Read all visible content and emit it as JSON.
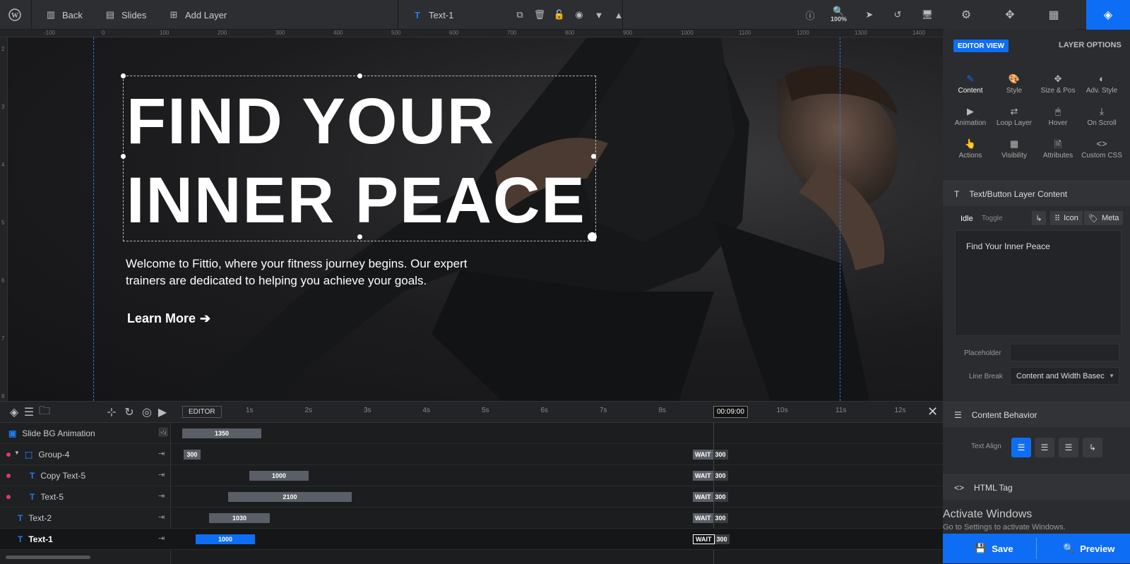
{
  "topbar": {
    "back_label": "Back",
    "slides_label": "Slides",
    "add_layer_label": "Add Layer",
    "selected_layer": "Text-1",
    "zoom": "100%"
  },
  "ruler_labels": [
    "-100",
    "0",
    "100",
    "200",
    "300",
    "400",
    "500",
    "600",
    "700",
    "800",
    "900",
    "1000",
    "1100",
    "1200",
    "1300",
    "1400"
  ],
  "vruler_labels": [
    "2",
    "3",
    "4",
    "5",
    "6",
    "7",
    "8"
  ],
  "canvas": {
    "headline": "FIND YOUR\nINNER PEACE",
    "subtext": "Welcome to Fittio, where your fitness journey begins. Our expert trainers are dedicated to helping you achieve your goals.",
    "button_label": "Learn More"
  },
  "timeline": {
    "editor_label": "EDITOR",
    "current_time": "00:09:00",
    "ticks": [
      "1s",
      "2s",
      "3s",
      "4s",
      "5s",
      "6s",
      "7s",
      "8s",
      "9s",
      "10s",
      "11s",
      "12s"
    ],
    "wait_label": "WAIT",
    "rows": [
      {
        "name": "Slide BG Animation",
        "bar": "1350",
        "wait": "",
        "end": ""
      },
      {
        "name": "Group-4",
        "bar": "300",
        "wait": "WAIT",
        "end": "300"
      },
      {
        "name": "Copy Text-5",
        "bar": "1000",
        "wait": "WAIT",
        "end": "300"
      },
      {
        "name": "Text-5",
        "bar": "2100",
        "wait": "WAIT",
        "end": "300"
      },
      {
        "name": "Text-2",
        "bar": "1030",
        "wait": "WAIT",
        "end": "300"
      },
      {
        "name": "Text-1",
        "bar": "1000",
        "wait": "WAIT",
        "end": "300"
      }
    ]
  },
  "panel": {
    "editor_view": "EDITOR VIEW",
    "layer_options": "LAYER OPTIONS",
    "options": [
      "Content",
      "Style",
      "Size & Pos",
      "Adv. Style",
      "Animation",
      "Loop Layer",
      "Hover",
      "On Scroll",
      "Actions",
      "Visibility",
      "Attributes",
      "Custom CSS"
    ],
    "content_section": "Text/Button Layer Content",
    "idle": "Idle",
    "toggle": "Toggle",
    "icon_label": "Icon",
    "meta_label": "Meta",
    "content_text": "Find Your Inner Peace",
    "placeholder_label": "Placeholder",
    "placeholder_value": "",
    "linebreak_label": "Line Break",
    "linebreak_value": "Content and Width Basec",
    "behavior_section": "Content Behavior",
    "text_align_label": "Text Align",
    "html_tag_section": "HTML Tag",
    "save_label": "Save",
    "preview_label": "Preview"
  },
  "watermark": {
    "title": "Activate Windows",
    "subtitle": "Go to Settings to activate Windows."
  },
  "colors": {
    "accent": "#0d6ef5",
    "marker": "#e2357a",
    "bar": "#5a5e66"
  }
}
